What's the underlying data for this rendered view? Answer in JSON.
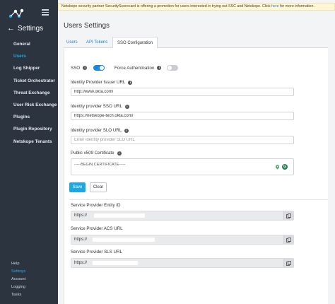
{
  "banner": {
    "text": "Netskope security partner SecurityScorecard is offering a promotion for users interested in trying out SSC and Netskope. Click ",
    "link": "here",
    "suffix": " for more information."
  },
  "sidebar": {
    "back_label": "Settings",
    "items": [
      {
        "label": "General",
        "active": false
      },
      {
        "label": "Users",
        "active": true
      },
      {
        "label": "Log Shipper",
        "active": false
      },
      {
        "label": "Ticket Orchestrator",
        "active": false
      },
      {
        "label": "Threat Exchange",
        "active": false
      },
      {
        "label": "User Risk Exchange",
        "active": false
      },
      {
        "label": "Plugins",
        "active": false
      },
      {
        "label": "Plugin Repository",
        "active": false
      },
      {
        "label": "Netskope Tenants",
        "active": false
      }
    ],
    "bottom_items": [
      {
        "label": "Help",
        "active": false
      },
      {
        "label": "Settings",
        "active": true
      },
      {
        "label": "Account",
        "active": false
      },
      {
        "label": "Logging",
        "active": false
      },
      {
        "label": "Tasks",
        "active": false
      }
    ]
  },
  "page": {
    "title": "Users Settings",
    "tabs": [
      {
        "label": "Users",
        "active": false
      },
      {
        "label": "API Tokens",
        "active": false
      },
      {
        "label": "SSO Configuration",
        "active": true
      }
    ]
  },
  "sso": {
    "sso_label": "SSO",
    "sso_on": true,
    "force_auth_label": "Force Authentication",
    "force_auth_on": false
  },
  "fields": {
    "idp_issuer_label": "Identity Provider Issuer URL",
    "idp_issuer_value": "http://www.okta.com/",
    "idp_sso_label": "Identity provider SSO URL",
    "idp_sso_value": "https://netskope-tech.okta.com/",
    "idp_slo_label": "Identity provider SLO URL",
    "idp_slo_placeholder": "Enter identity provider SLO URL",
    "cert_label": "Public x509 Certificate",
    "cert_value": "-----BEGIN CERTIFICATE-----"
  },
  "buttons": {
    "save": "Save",
    "clear": "Clear"
  },
  "service_provider": {
    "entity_label": "Service Provider Entity ID",
    "entity_value": "https://",
    "acs_label": "Service Provider ACS URL",
    "acs_value": "https://",
    "sls_label": "Service Provider SLS URL",
    "sls_value": "https://"
  },
  "icons": {
    "info": "info-icon",
    "copy": "copy-icon",
    "back": "arrow-left-icon",
    "menu": "hamburger-icon",
    "logo": "netskope-logo",
    "pin": "map-pin-icon",
    "grammarly": "grammarly-icon"
  },
  "colors": {
    "sidebar_bg": "#2c3440",
    "accent": "#27a5e6",
    "save_button": "#1fa8e0",
    "toggle_on": "#1e88d6"
  }
}
